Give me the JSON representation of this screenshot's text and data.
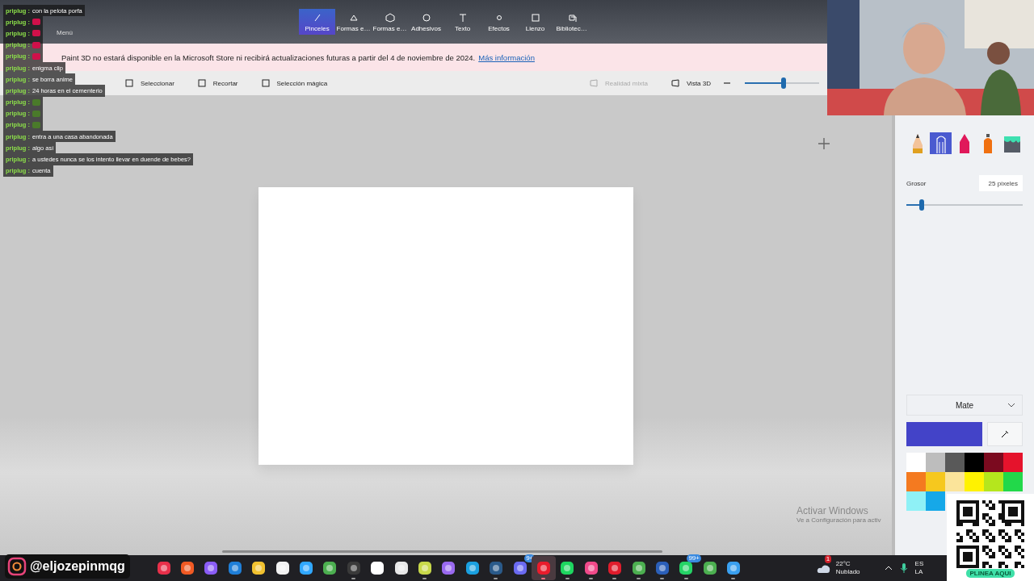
{
  "app": {
    "menu_label": "Menú",
    "tabs": [
      {
        "label": "Pinceles",
        "selected": true
      },
      {
        "label": "Formas e…",
        "selected": false
      },
      {
        "label": "Formas e…",
        "selected": false
      },
      {
        "label": "Adhesivos",
        "selected": false
      },
      {
        "label": "Texto",
        "selected": false
      },
      {
        "label": "Efectos",
        "selected": false
      },
      {
        "label": "Lienzo",
        "selected": false
      },
      {
        "label": "Bibliotec…",
        "selected": false
      }
    ],
    "banner": {
      "text": "Paint 3D no estará disponible en la Microsoft Store ni recibirá actualizaciones futuras a partir del 4 de noviembre de 2024.",
      "link": "Más información"
    },
    "toolbar": {
      "left": [
        {
          "label": "Seleccionar",
          "disabled": false
        },
        {
          "label": "Recortar",
          "disabled": false
        },
        {
          "label": "Selección mágica",
          "disabled": false
        }
      ],
      "right": [
        {
          "label": "Realidad mixta",
          "disabled": true
        },
        {
          "label": "Vista 3D",
          "disabled": false
        }
      ],
      "zoom": {
        "level": 0.52
      }
    },
    "side_panel": {
      "brushes": [
        {
          "kind": "pencil",
          "selected": false
        },
        {
          "kind": "marker",
          "selected": true
        },
        {
          "kind": "crayon",
          "selected": false
        },
        {
          "kind": "spray",
          "selected": false
        },
        {
          "kind": "bucket",
          "selected": false
        }
      ],
      "thickness": {
        "label": "Grosor",
        "value": "25 píxeles",
        "level": 0.13
      },
      "finish": "Mate",
      "current_color": {
        "color": "#4343c8"
      },
      "palette": [
        {
          "color": "#ffffff"
        },
        {
          "color": "#bdbdbd"
        },
        {
          "color": "#595959"
        },
        {
          "color": "#000000"
        },
        {
          "color": "#7b0a1f"
        },
        {
          "color": "#e5132c"
        },
        {
          "color": "#f47a20"
        },
        {
          "color": "#f6c81e"
        },
        {
          "color": "#fbe49a"
        },
        {
          "color": "#fff200"
        },
        {
          "color": "#b5e61d"
        },
        {
          "color": "#22d84a"
        },
        {
          "color": "#8ff1f6"
        },
        {
          "color": "#16a8e8"
        }
      ]
    }
  },
  "windows_notice": {
    "title": "Activar Windows",
    "subtitle": "Ve a Configuración para activ"
  },
  "chat": [
    {
      "user": "priplug :",
      "kind": "text",
      "text": "con la pelota porfa"
    },
    {
      "user": "priplug :",
      "kind": "emote",
      "color": "#d0104a"
    },
    {
      "user": "priplug :",
      "kind": "emote",
      "color": "#d0104a"
    },
    {
      "user": "priplug :",
      "kind": "emote",
      "color": "#d0104a"
    },
    {
      "user": "priplug :",
      "kind": "emote",
      "color": "#d0104a"
    },
    {
      "user": "priplug :",
      "kind": "text",
      "text": "enigma clip"
    },
    {
      "user": "priplug :",
      "kind": "text",
      "text": "se borra anime"
    },
    {
      "user": "priplug :",
      "kind": "text",
      "text": "24 horas en el cementerio"
    },
    {
      "user": "priplug :",
      "kind": "emote",
      "color": "#4a7a2a"
    },
    {
      "user": "priplug :",
      "kind": "emote",
      "color": "#4a7a2a"
    },
    {
      "user": "priplug :",
      "kind": "emote",
      "color": "#4a7a2a"
    },
    {
      "user": "priplug :",
      "kind": "text",
      "text": "entra a una casa abandonada"
    },
    {
      "user": "priplug :",
      "kind": "text",
      "text": "algo así"
    },
    {
      "user": "priplug :",
      "kind": "text",
      "text": "a ustedes nunca se los intento llevar en duende de bebes?"
    },
    {
      "user": "priplug :",
      "kind": "text",
      "text": "cuenta"
    }
  ],
  "social": {
    "handle": "@eljozepinmqg"
  },
  "qr": {
    "caption": "PLINEA AQUI"
  },
  "taskbar": {
    "apps": [
      {
        "color": "#e8304a",
        "running": false,
        "selected": false
      },
      {
        "color": "#f15a24",
        "running": false,
        "selected": false
      },
      {
        "color": "#8a5cf6",
        "running": false,
        "selected": false
      },
      {
        "color": "#1f7fd8",
        "running": false,
        "selected": false
      },
      {
        "color": "#f2c230",
        "running": false,
        "selected": false
      },
      {
        "color": "#f2f2f2",
        "running": false,
        "selected": false
      },
      {
        "color": "#31a8ff",
        "running": false,
        "selected": false
      },
      {
        "color": "#4caf50",
        "running": false,
        "selected": false
      },
      {
        "color": "#3a3a3a",
        "running": true,
        "selected": false
      },
      {
        "color": "#ffffff",
        "running": false,
        "selected": false
      },
      {
        "color": "#e8e8e8",
        "running": false,
        "selected": false
      },
      {
        "color": "#c8d84a",
        "running": true,
        "selected": false
      },
      {
        "color": "#9a6af0",
        "running": false,
        "selected": false
      },
      {
        "color": "#1aa0e0",
        "running": false,
        "selected": false
      },
      {
        "color": "#2a5a8a",
        "running": true,
        "selected": false
      },
      {
        "color": "#6a6af0",
        "running": false,
        "selected": false,
        "badge": "9+"
      },
      {
        "color": "#e81c2c",
        "running": true,
        "selected": true
      },
      {
        "color": "#1ed760",
        "running": true,
        "selected": false
      },
      {
        "color": "#f04a8a",
        "running": true,
        "selected": false
      },
      {
        "color": "#e01c2c",
        "running": true,
        "selected": false
      },
      {
        "color": "#4caf50",
        "running": true,
        "selected": false
      },
      {
        "color": "#2b5fb8",
        "running": true,
        "selected": false
      },
      {
        "color": "#25d366",
        "running": true,
        "selected": false,
        "badge": "99+"
      },
      {
        "color": "#4caf50",
        "running": false,
        "selected": false
      },
      {
        "color": "#3aa0f0",
        "running": true,
        "selected": false
      }
    ],
    "weather": {
      "temp": "22°C",
      "condition": "Nublado",
      "badge": "1"
    },
    "lang": [
      "ES",
      "LA"
    ]
  }
}
